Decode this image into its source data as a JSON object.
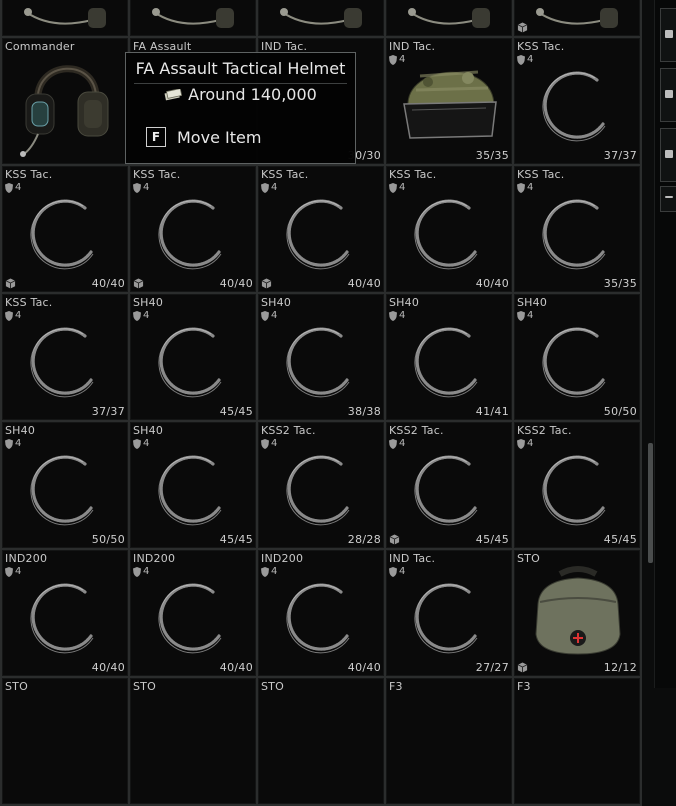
{
  "tooltip": {
    "title": "FA Assault Tactical Helmet",
    "price": "Around 140,000",
    "price_icon": "money-icon",
    "key": "F",
    "action": "Move Item"
  },
  "rows": [
    [
      {
        "name": "",
        "tier": "",
        "dur": "",
        "art": "headset-partial",
        "found": false
      },
      {
        "name": "",
        "tier": "",
        "dur": "",
        "art": "headset-partial",
        "found": false
      },
      {
        "name": "",
        "tier": "",
        "dur": "",
        "art": "headset-partial",
        "found": false
      },
      {
        "name": "",
        "tier": "",
        "dur": "",
        "art": "headset-partial",
        "found": false
      },
      {
        "name": "",
        "tier": "",
        "dur": "",
        "art": "headset-partial",
        "found": true
      }
    ],
    [
      {
        "name": "Commander",
        "tier": "",
        "dur": "",
        "art": "headset",
        "found": false
      },
      {
        "name": "FA Assault",
        "tier": "",
        "dur": "",
        "art": "helmet-hidden",
        "found": false
      },
      {
        "name": "IND Tac.",
        "tier": "",
        "dur": "30/30",
        "art": "none",
        "found": false
      },
      {
        "name": "IND Tac.",
        "tier": "4",
        "dur": "35/35",
        "art": "helmet",
        "found": false
      },
      {
        "name": "KSS Tac.",
        "tier": "4",
        "dur": "37/37",
        "art": "ring",
        "found": false
      }
    ],
    [
      {
        "name": "KSS Tac.",
        "tier": "4",
        "dur": "40/40",
        "art": "ring",
        "found": true
      },
      {
        "name": "KSS Tac.",
        "tier": "4",
        "dur": "40/40",
        "art": "ring",
        "found": true
      },
      {
        "name": "KSS Tac.",
        "tier": "4",
        "dur": "40/40",
        "art": "ring",
        "found": true
      },
      {
        "name": "KSS Tac.",
        "tier": "4",
        "dur": "40/40",
        "art": "ring",
        "found": false
      },
      {
        "name": "KSS Tac.",
        "tier": "4",
        "dur": "35/35",
        "art": "ring",
        "found": false
      }
    ],
    [
      {
        "name": "KSS Tac.",
        "tier": "4",
        "dur": "37/37",
        "art": "ring",
        "found": false
      },
      {
        "name": "SH40",
        "tier": "4",
        "dur": "45/45",
        "art": "ring",
        "found": false
      },
      {
        "name": "SH40",
        "tier": "4",
        "dur": "38/38",
        "art": "ring",
        "found": false
      },
      {
        "name": "SH40",
        "tier": "4",
        "dur": "41/41",
        "art": "ring",
        "found": false
      },
      {
        "name": "SH40",
        "tier": "4",
        "dur": "50/50",
        "art": "ring",
        "found": false
      }
    ],
    [
      {
        "name": "SH40",
        "tier": "4",
        "dur": "50/50",
        "art": "ring",
        "found": false
      },
      {
        "name": "SH40",
        "tier": "4",
        "dur": "45/45",
        "art": "ring",
        "found": false
      },
      {
        "name": "KSS2 Tac.",
        "tier": "4",
        "dur": "28/28",
        "art": "ring",
        "found": false
      },
      {
        "name": "KSS2 Tac.",
        "tier": "4",
        "dur": "45/45",
        "art": "ring",
        "found": true
      },
      {
        "name": "KSS2 Tac.",
        "tier": "4",
        "dur": "45/45",
        "art": "ring",
        "found": false
      }
    ],
    [
      {
        "name": "IND200",
        "tier": "4",
        "dur": "40/40",
        "art": "ring",
        "found": false
      },
      {
        "name": "IND200",
        "tier": "4",
        "dur": "40/40",
        "art": "ring",
        "found": false
      },
      {
        "name": "IND200",
        "tier": "4",
        "dur": "40/40",
        "art": "ring",
        "found": false
      },
      {
        "name": "IND Tac.",
        "tier": "4",
        "dur": "27/27",
        "art": "ring",
        "found": false
      },
      {
        "name": "STO",
        "tier": "",
        "dur": "12/12",
        "art": "case",
        "found": true
      }
    ],
    [
      {
        "name": "STO",
        "tier": "",
        "dur": "",
        "art": "none",
        "found": false
      },
      {
        "name": "STO",
        "tier": "",
        "dur": "",
        "art": "none",
        "found": false
      },
      {
        "name": "STO",
        "tier": "",
        "dur": "",
        "art": "none",
        "found": false
      },
      {
        "name": "F3",
        "tier": "",
        "dur": "",
        "art": "none",
        "found": false
      },
      {
        "name": "F3",
        "tier": "",
        "dur": "",
        "art": "none",
        "found": false
      }
    ]
  ],
  "side_buttons": [
    "side-button-1",
    "side-button-2",
    "side-button-3",
    "side-button-4"
  ]
}
